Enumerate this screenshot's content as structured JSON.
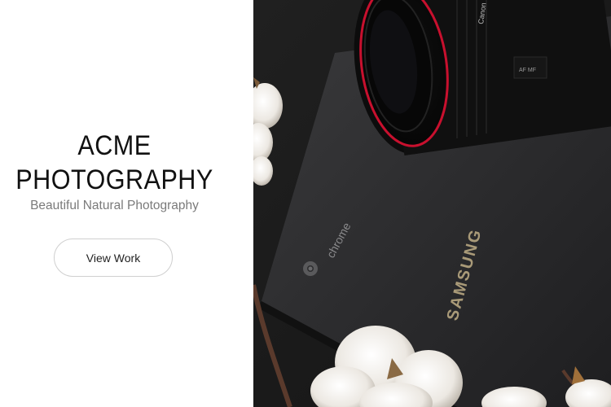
{
  "brand": {
    "title_line1": "ACME",
    "title_line2": "PHOTOGRAPHY",
    "tagline": "Beautiful Natural Photography"
  },
  "cta": {
    "label": "View Work"
  },
  "hero": {
    "laptop_logo_text": "chrome",
    "laptop_brand_text": "SAMSUNG",
    "lens_text": "Canon",
    "colors": {
      "background": "#1b1b1b",
      "laptop": "#2d2d2f",
      "lens_ring": "#c8102e"
    }
  }
}
